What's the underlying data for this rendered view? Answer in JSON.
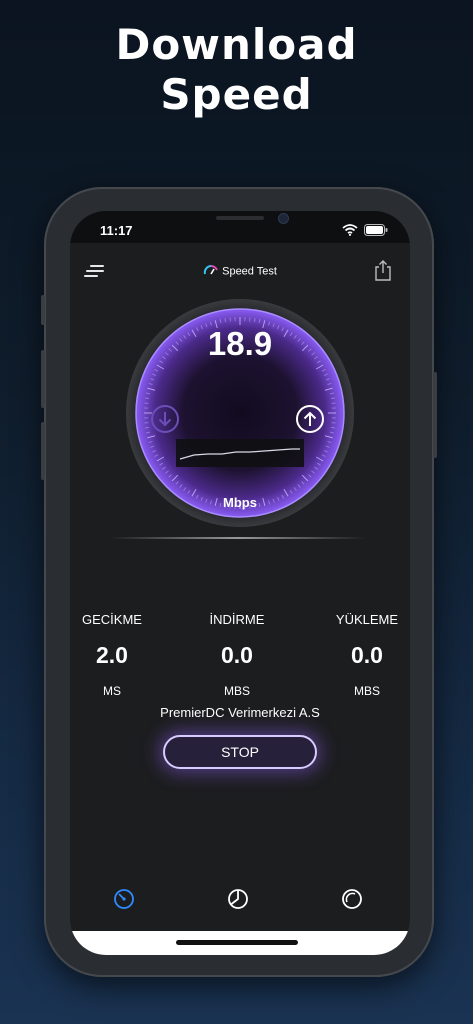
{
  "headline": {
    "line1": "Download",
    "line2": "Speed"
  },
  "status_bar": {
    "time": "11:17"
  },
  "app": {
    "title": "Speed Test",
    "speed_value": "18.9",
    "speed_unit": "Mbps"
  },
  "stats": [
    {
      "label": "GECİKME",
      "value": "2.0",
      "unit": "MS"
    },
    {
      "label": "İNDİRME",
      "value": "0.0",
      "unit": "MBS"
    },
    {
      "label": "YÜKLEME",
      "value": "0.0",
      "unit": "MBS"
    }
  ],
  "server": "PremierDC Verimerkezi A.S",
  "stop_label": "STOP",
  "tabs": [
    {
      "icon": "speedometer-icon",
      "active": true
    },
    {
      "icon": "history-icon",
      "active": false
    },
    {
      "icon": "settings-dial-icon",
      "active": false
    }
  ],
  "colors": {
    "accent_purple": "#8a5cf5",
    "active_tab": "#2f8cff",
    "background": "#1c1d1f"
  }
}
